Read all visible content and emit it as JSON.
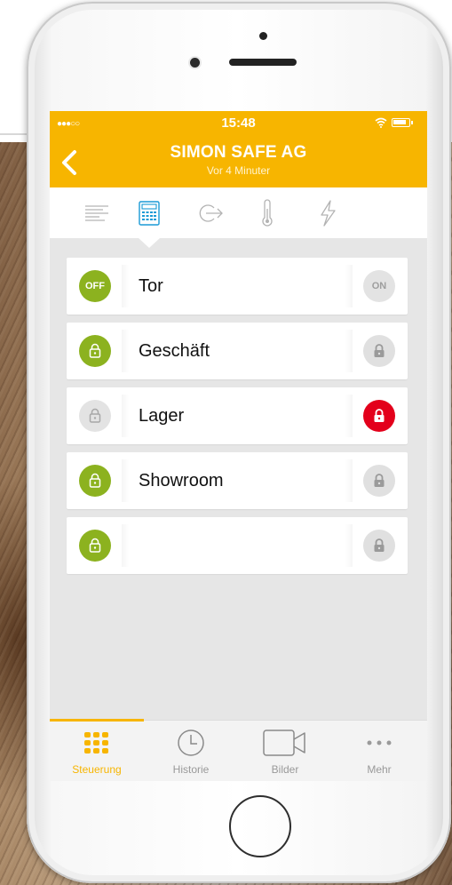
{
  "status": {
    "time": "15:48"
  },
  "header": {
    "title": "SIMON SAFE AG",
    "subtitle": "Vor 4 Minuter"
  },
  "top_tabs": [
    {
      "icon": "list-lines-icon",
      "active": false
    },
    {
      "icon": "calculator-keypad-icon",
      "active": true
    },
    {
      "icon": "exit-arrow-icon",
      "active": false
    },
    {
      "icon": "thermometer-icon",
      "active": false
    },
    {
      "icon": "lightning-bolt-icon",
      "active": false
    }
  ],
  "rows": [
    {
      "label": "Tor",
      "left": "OFF",
      "right": "ON"
    },
    {
      "label": "Geschäft"
    },
    {
      "label": "Lager"
    },
    {
      "label": "Showroom"
    },
    {
      "label": ""
    }
  ],
  "bottom_tabs": [
    {
      "label": "Steuerung",
      "icon": "grid-dots-icon",
      "active": true
    },
    {
      "label": "Historie",
      "icon": "clock-icon",
      "active": false
    },
    {
      "label": "Bilder",
      "icon": "video-camera-icon",
      "active": false
    },
    {
      "label": "Mehr",
      "icon": "more-dots-icon",
      "active": false
    }
  ],
  "colors": {
    "accent": "#f7b500",
    "green": "#8cb21f",
    "red": "#e3001b",
    "inactive": "#e0e0e0"
  }
}
